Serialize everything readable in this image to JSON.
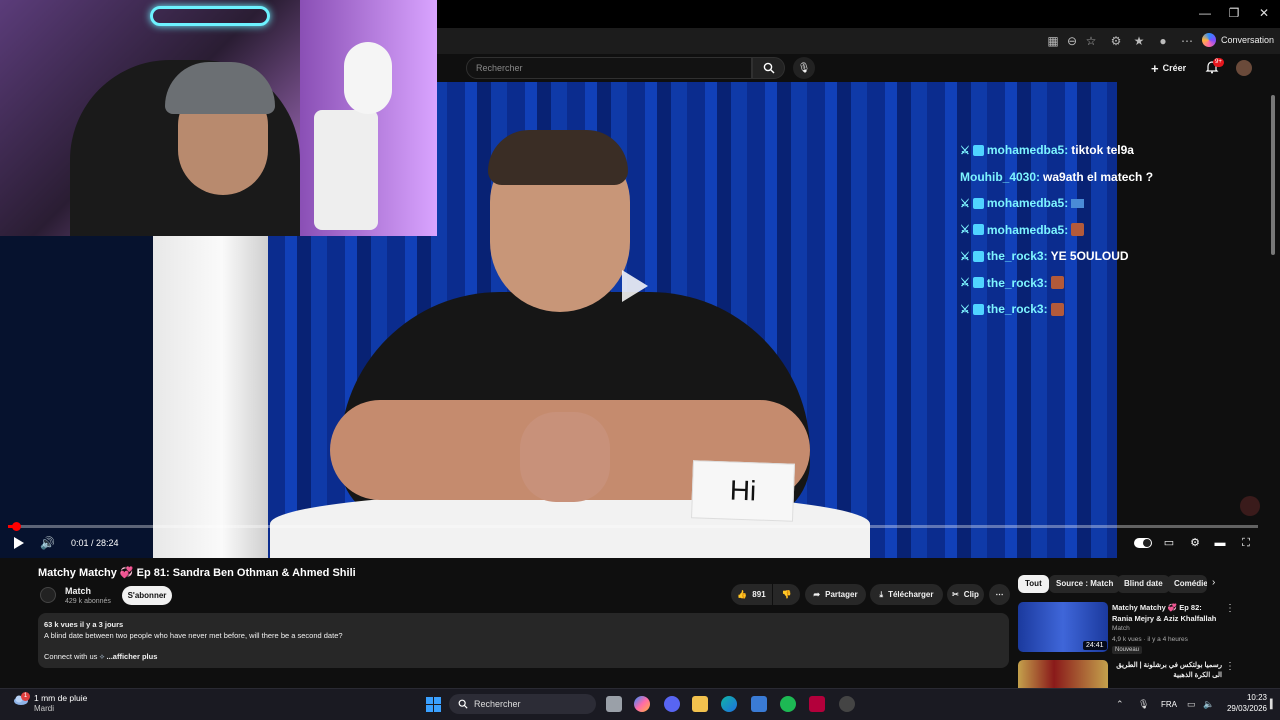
{
  "browser": {
    "conversation_label": "Conversation"
  },
  "youtube": {
    "search_placeholder": "Rechercher",
    "create_label": "Créer",
    "notif_badge": "9+"
  },
  "player": {
    "time": "0:01 / 28:24",
    "progress_fraction": 0.001,
    "card_text": "Hi"
  },
  "chat": [
    {
      "user": "mohamedba5:",
      "message": "tiktok tel9a",
      "badge": true,
      "emote": ""
    },
    {
      "user": "Mouhib_4030:",
      "message": "wa9ath el matech ?",
      "badge": false,
      "emote": ""
    },
    {
      "user": "mohamedba5:",
      "message": "",
      "badge": true,
      "emote": "blue"
    },
    {
      "user": "mohamedba5:",
      "message": "",
      "badge": true,
      "emote": "red"
    },
    {
      "user": "the_rock3:",
      "message": "YE 5OULOUD",
      "badge": true,
      "emote": ""
    },
    {
      "user": "the_rock3:",
      "message": "",
      "badge": true,
      "emote": "red"
    },
    {
      "user": "the_rock3:",
      "message": "",
      "badge": true,
      "emote": "red"
    }
  ],
  "video": {
    "title": "Matchy Matchy 💞 Ep 81: Sandra Ben Othman & Ahmed Shili",
    "channel": "Match",
    "subscribers": "429 k abonnés",
    "subscribe_label": "S'abonner",
    "likes": "891",
    "share_label": "Partager",
    "download_label": "Télécharger",
    "clip_label": "Clip",
    "description": {
      "stats": "63 k vues  il y a 3 jours",
      "line1": "A blind date between two people who have never met before, will there be a second date?",
      "line2": "Connect with us",
      "more": "...afficher plus"
    }
  },
  "sidebar": {
    "chips": [
      "Tout",
      "Source : Match",
      "Blind date",
      "Comédie"
    ],
    "recommendations": [
      {
        "title": "Matchy Matchy 💞 Ep 82: Rania Mejry & Aziz Khalfallah",
        "channel": "Match",
        "meta": "4,9 k vues · il y a 4 heures",
        "badge": "Nouveau",
        "duration": "24:41"
      },
      {
        "title": "رسميا بولتكس في برشلونة | الطريق الى الكرة الذهبية"
      }
    ]
  },
  "taskbar": {
    "weather": "1 mm de pluie",
    "weather_badge": "1",
    "day": "Mardi",
    "search_label": "Rechercher",
    "language": "FRA",
    "time": "10:23",
    "date": "29/03/2026"
  },
  "colors": {
    "accent_red": "#ff0000",
    "chat_user": "#7df4ff",
    "background": "#0f0f0f"
  }
}
